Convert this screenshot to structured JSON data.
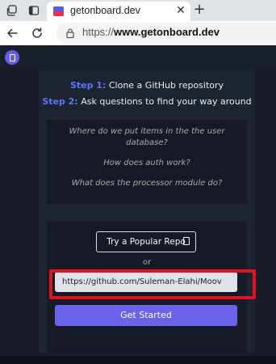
{
  "browser": {
    "tab_title": "getonboard.dev",
    "tab_close": "✕",
    "new_tab": "+",
    "url_prefix": "https://",
    "url_domain": "www.getonboard.dev"
  },
  "page": {
    "steps": [
      {
        "num": "Step 1:",
        "text": " Clone a GitHub repository"
      },
      {
        "num": "Step 2:",
        "text": " Ask questions to find your way around"
      }
    ],
    "questions": [
      "Where do we put items in the the user database?",
      "How does auth work?",
      "What does the processor module do?"
    ],
    "popular_button": "Try a Popular Repo",
    "or": "or",
    "repo_input_value": "https://github.com/Suleman-Elahi/Moov",
    "get_started": "Get Started"
  },
  "colors": {
    "accent": "#6a62e8",
    "step_label": "#5b73ff",
    "highlight": "#e2111d",
    "background": "#171c28"
  }
}
